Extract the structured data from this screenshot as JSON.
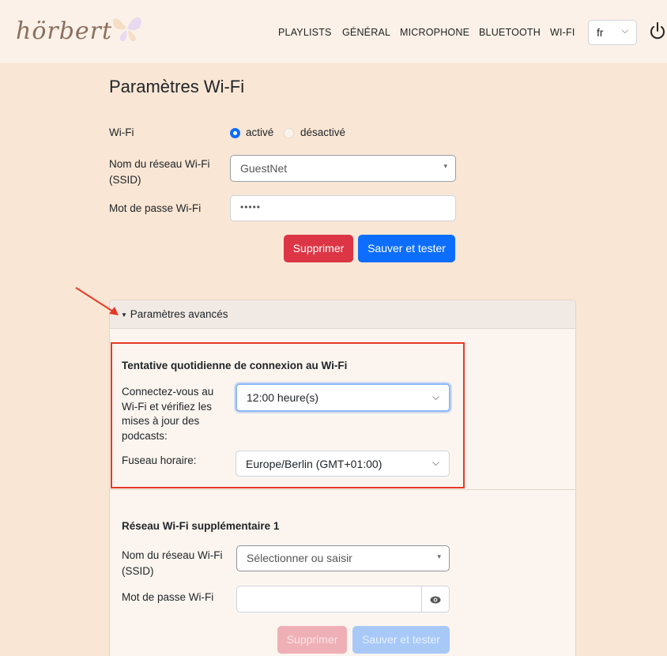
{
  "header": {
    "logo_text": "hörbert",
    "nav": [
      {
        "label": "PLAYLISTS"
      },
      {
        "label": "GÉNÉRAL"
      },
      {
        "label": "MICROPHONE"
      },
      {
        "label": "BLUETOOTH"
      },
      {
        "label": "WI-FI"
      }
    ],
    "language": "fr",
    "icons": {
      "power": "power-icon",
      "language_chevron": "chevron-down-icon",
      "logo_decoration": "butterfly-icon"
    }
  },
  "wifi": {
    "title": "Paramètres Wi-Fi",
    "wifi_label": "Wi-Fi",
    "radio_on_label": "activé",
    "radio_off_label": "désactivé",
    "radio_selected": "activé",
    "ssid_label": "Nom du réseau Wi-Fi (SSID)",
    "ssid_value": "GuestNet",
    "password_label": "Mot de passe Wi-Fi",
    "password_value": "•••••",
    "delete_button": "Supprimer",
    "save_button": "Sauver et tester"
  },
  "advanced": {
    "header": "Paramètres avancés",
    "daily": {
      "title": "Tentative quotidienne de connexion au Wi-Fi",
      "connect_label": "Connectez-vous au Wi-Fi et vérifiez les mises à jour des podcasts:",
      "connect_value": "12:00 heure(s)",
      "timezone_label": "Fuseau horaire:",
      "timezone_value": "Europe/Berlin (GMT+01:00)"
    },
    "extra_network": {
      "title": "Réseau Wi-Fi supplémentaire 1",
      "ssid_label": "Nom du réseau Wi-Fi (SSID)",
      "ssid_placeholder": "Sélectionner ou saisir",
      "password_label": "Mot de passe Wi-Fi",
      "password_value": "",
      "delete_button": "Supprimer",
      "save_button": "Sauver et tester",
      "eye_icon": "eye-icon"
    }
  },
  "colors": {
    "page_background": "#f9e6d4",
    "primary": "#0d6efd",
    "danger": "#dc3545",
    "annotation": "#e53927"
  }
}
